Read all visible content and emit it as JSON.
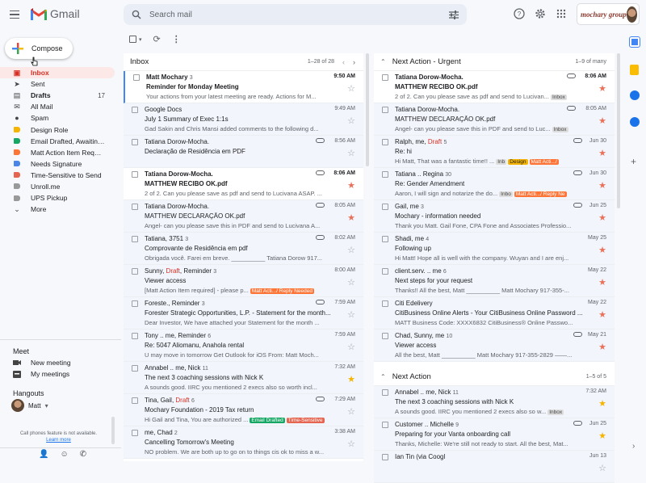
{
  "app": {
    "name": "Gmail"
  },
  "search": {
    "placeholder": "Search mail"
  },
  "brand": {
    "text": "mochary group"
  },
  "compose": {
    "label": "Compose"
  },
  "nav": [
    {
      "label": "Inbox",
      "count": "",
      "active": true,
      "icon": "inbox-icon"
    },
    {
      "label": "Sent",
      "count": "",
      "icon": "send-icon"
    },
    {
      "label": "Drafts",
      "count": "17",
      "bold": true,
      "icon": "draft-icon"
    },
    {
      "label": "All Mail",
      "count": "",
      "icon": "mail-icon"
    },
    {
      "label": "Spam",
      "count": "",
      "icon": "spam-icon"
    },
    {
      "label": "Design Role",
      "count": "",
      "label_color": "#f4b400"
    },
    {
      "label": "Email Drafted, Awaiting ...",
      "count": "",
      "label_color": "#16a765"
    },
    {
      "label": "Matt Action Item Requir...",
      "count": "",
      "label_color": "#ff7537"
    },
    {
      "label": "Needs Signature",
      "count": "",
      "label_color": "#4a86e8"
    },
    {
      "label": "Time-Sensitive to Send",
      "count": "",
      "label_color": "#e66550"
    },
    {
      "label": "Unroll.me",
      "count": "",
      "label_color": "#999999"
    },
    {
      "label": "UPS Pickup",
      "count": "",
      "label_color": "#999999"
    },
    {
      "label": "More",
      "count": "",
      "icon": "chevron-down-icon"
    }
  ],
  "meet": {
    "title": "Meet",
    "new_meeting": "New meeting",
    "my_meetings": "My meetings"
  },
  "hangouts": {
    "title": "Hangouts",
    "user": "Matt",
    "note": "Call phones feature is not available.",
    "learn_more": "Learn more"
  },
  "inbox": {
    "title": "Inbox",
    "range": "1–28 of 28",
    "rows": [
      {
        "from": "Matt Mochary",
        "n": "3",
        "draft": "",
        "subject": "Reminder for Monday Meeting",
        "snippet": "Your actions from your latest meeting are ready. Actions for M...",
        "time": "9:50 AM",
        "unread": true,
        "starred": false,
        "clip": false,
        "tags": [],
        "selected": true
      },
      {
        "from": "Google Docs",
        "n": "",
        "draft": "",
        "subject": "July 1 Summary of Exec 1:1s",
        "snippet": "Gad Sakin and Chris Mansi added comments to the following d...",
        "time": "9:49 AM",
        "unread": false,
        "starred": false,
        "clip": false,
        "tags": []
      },
      {
        "from": "Tatiana Dorow-Mocha.",
        "n": "",
        "draft": "",
        "subject": "Declaração de Residência em PDF",
        "snippet": "",
        "time": "8:56 AM",
        "unread": false,
        "starred": false,
        "clip": true,
        "tags": []
      },
      {
        "from": "Tatiana Dorow-Mocha.",
        "n": "",
        "draft": "",
        "subject": "MATTHEW RECIBO OK.pdf",
        "snippet": "2 of 2. Can you please save as pdf and send to Lucivana ASAP. ...",
        "time": "8:06 AM",
        "unread": true,
        "starred": true,
        "clip": true,
        "tags": []
      },
      {
        "from": "Tatiana Dorow-Mocha.",
        "n": "",
        "draft": "",
        "subject": "MATTHEW DECLARAÇÃO OK.pdf",
        "snippet": "Angel- can you please save this in PDF and send to Lucivana A...",
        "time": "8:05 AM",
        "unread": false,
        "starred": true,
        "clip": true,
        "tags": []
      },
      {
        "from": "Tatiana, 3751",
        "n": "3",
        "draft": "",
        "subject": "Comprovante de Residência em pdf",
        "snippet": "Obrigada você. Farei em breve. __________ Tatiana Dorow 917...",
        "time": "8:02 AM",
        "unread": false,
        "starred": false,
        "clip": true,
        "tags": []
      },
      {
        "from": "Sunny, ",
        "n": "3",
        "draft": "Draft",
        "from2": ", Reminder",
        "subject": "Viewer access",
        "snippet": "[Matt Action Item required] - please p...",
        "time": "8:00 AM",
        "unread": false,
        "starred": false,
        "clip": false,
        "tags": [
          {
            "t": "Matt Acti.../ Reply Needed",
            "c": "#ff7537",
            "f": "#fff"
          }
        ]
      },
      {
        "from": "Foreste., Reminder",
        "n": "3",
        "draft": "",
        "subject": "Forester Strategic Opportunities, L.P. - Statement for the month...",
        "snippet": "Dear Investor, We have attached your Statement for the month ...",
        "time": "7:59 AM",
        "unread": false,
        "starred": false,
        "clip": true,
        "tags": []
      },
      {
        "from": "Tony .. me, Reminder",
        "n": "6",
        "draft": "",
        "subject": "Re: 5047 Aliomanu, Anahola rental",
        "snippet": "U may move in tomorrow Get Outlook for iOS From: Matt Moch...",
        "time": "7:59 AM",
        "unread": false,
        "starred": false,
        "clip": false,
        "tags": []
      },
      {
        "from": "Annabel .. me, Nick",
        "n": "11",
        "draft": "",
        "subject": "The next 3 coaching sessions with Nick K",
        "snippet": "A sounds good. IIRC you mentioned 2 execs also so worth incl...",
        "time": "7:32 AM",
        "unread": false,
        "starred": true,
        "star_color": "#f4b400",
        "clip": false,
        "tags": []
      },
      {
        "from": "Tina, Gail, ",
        "n": "6",
        "draft": "Draft",
        "from2": "",
        "subject": "Mochary Foundation - 2019 Tax return",
        "snippet": "Hi Gail and Tina, You are authorized ...",
        "time": "7:29 AM",
        "unread": false,
        "starred": false,
        "clip": true,
        "tags": [
          {
            "t": "Email Drafted",
            "c": "#16a765",
            "f": "#fff"
          },
          {
            "t": "Time-Sensitive",
            "c": "#e66550",
            "f": "#fff"
          }
        ]
      },
      {
        "from": "me, Chad",
        "n": "2",
        "draft": "",
        "subject": "Cancelling Tomorrow's Meeting",
        "snippet": "NO problem. We are both up to go on to things cis ok to miss a w...",
        "time": "3:38 AM",
        "unread": false,
        "starred": false,
        "clip": false,
        "tags": []
      }
    ]
  },
  "urgent": {
    "title": "Next Action - Urgent",
    "range": "1–9 of many",
    "rows": [
      {
        "from": "Tatiana Dorow-Mocha.",
        "n": "",
        "draft": "",
        "subject": "MATTHEW RECIBO OK.pdf",
        "snippet": "2 of 2. Can you please save as pdf and send to Lucivan...",
        "time": "8:06 AM",
        "unread": true,
        "starred": true,
        "clip": true,
        "tags": [
          {
            "t": "Inbox",
            "c": "#ddd",
            "f": "#444"
          }
        ]
      },
      {
        "from": "Tatiana Dorow-Mocha.",
        "n": "",
        "draft": "",
        "subject": "MATTHEW DECLARAÇÃO OK.pdf",
        "snippet": "Angel- can you please save this in PDF and send to Luc...",
        "time": "8:05 AM",
        "unread": false,
        "starred": true,
        "clip": true,
        "tags": [
          {
            "t": "Inbox",
            "c": "#ddd",
            "f": "#444"
          }
        ]
      },
      {
        "from": "Ralph, me, ",
        "n": "5",
        "draft": "Draft",
        "from2": "",
        "subject": "Re: hi",
        "snippet": "Hi Matt, That was a fantastic time!! ...",
        "time": "Jun 30",
        "unread": false,
        "starred": true,
        "clip": true,
        "tags": [
          {
            "t": "Inb",
            "c": "#ddd",
            "f": "#444"
          },
          {
            "t": "Design",
            "c": "#f4b400",
            "f": "#222"
          },
          {
            "t": "Matt Acti.../",
            "c": "#ff7537",
            "f": "#fff"
          }
        ]
      },
      {
        "from": "Tatiana .. Regina",
        "n": "30",
        "draft": "",
        "subject": "Re: Gender Amendment",
        "snippet": "Aaron, I will sign and notarize the do...",
        "time": "Jun 30",
        "unread": false,
        "starred": true,
        "clip": true,
        "tags": [
          {
            "t": "Inbo",
            "c": "#ddd",
            "f": "#444"
          },
          {
            "t": "Matt Acti.../ Reply Ne",
            "c": "#ff7537",
            "f": "#fff"
          }
        ]
      },
      {
        "from": "Gail, me",
        "n": "3",
        "draft": "",
        "subject": "Mochary - information needed",
        "snippet": "Thank you Matt. Gail Fone, CPA Fone and Associates Professio...",
        "time": "Jun 25",
        "unread": false,
        "starred": true,
        "clip": true,
        "tags": []
      },
      {
        "from": "Shadi, me",
        "n": "4",
        "draft": "",
        "subject": "Following up",
        "snippet": "Hi Matt! Hope all is well with the company. Wuyan and I are enj...",
        "time": "May 25",
        "unread": false,
        "starred": true,
        "clip": false,
        "tags": []
      },
      {
        "from": "client.serv. .. me",
        "n": "6",
        "draft": "",
        "subject": "Next steps for your request",
        "snippet": "Thanks!! All the best, Matt __________ Matt Mochary 917-355-...",
        "time": "May 22",
        "unread": false,
        "starred": true,
        "clip": false,
        "tags": []
      },
      {
        "from": "Citi Edelivery",
        "n": "",
        "draft": "",
        "subject": "CitiBusiness Online Alerts - Your CitiBusiness Online Password ...",
        "snippet": "MATT Business Code: XXXX6832 CitiBusiness® Online Passwo...",
        "time": "May 22",
        "unread": false,
        "starred": true,
        "clip": false,
        "tags": []
      },
      {
        "from": "Chad, Sunny, me",
        "n": "10",
        "draft": "",
        "subject": "Viewer access",
        "snippet": "All the best, Matt __________ Matt Mochary 917-355-2829 ——...",
        "time": "May 21",
        "unread": false,
        "starred": true,
        "clip": true,
        "tags": []
      }
    ]
  },
  "next": {
    "title": "Next Action",
    "range": "1–5 of 5",
    "rows": [
      {
        "from": "Annabel .. me, Nick",
        "n": "11",
        "draft": "",
        "subject": "The next 3 coaching sessions with Nick K",
        "snippet": "A sounds good. IIRC you mentioned 2 execs also so w...",
        "time": "7:32 AM",
        "unread": false,
        "starred": true,
        "star_color": "#f4b400",
        "clip": false,
        "tags": [
          {
            "t": "Inbox",
            "c": "#ddd",
            "f": "#444"
          }
        ]
      },
      {
        "from": "Customer .. Michelle",
        "n": "9",
        "draft": "",
        "subject": "Preparing for your Vanta onboarding call",
        "snippet": "Thanks, Michelle: We're still not ready to start. All the best, Mat...",
        "time": "Jun 25",
        "unread": false,
        "starred": true,
        "star_color": "#f4b400",
        "clip": true,
        "tags": []
      },
      {
        "from": "Ian Tin (via Coogl",
        "n": "",
        "draft": "",
        "subject": "",
        "snippet": "",
        "time": "Jun 13",
        "unread": false,
        "starred": false,
        "clip": false,
        "tags": []
      }
    ]
  }
}
